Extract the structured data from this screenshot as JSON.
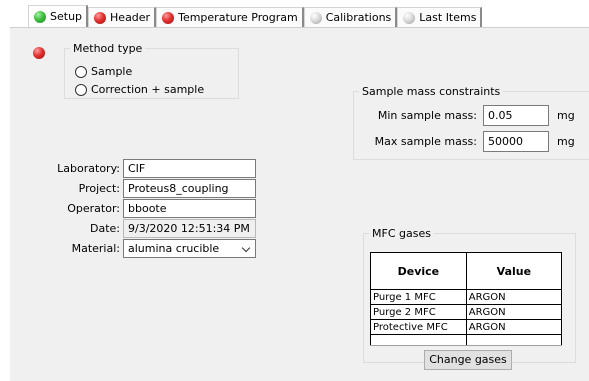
{
  "tabs": [
    {
      "label": "Setup",
      "status": "green",
      "active": true
    },
    {
      "label": "Header",
      "status": "red",
      "active": false
    },
    {
      "label": "Temperature Program",
      "status": "red",
      "active": false
    },
    {
      "label": "Calibrations",
      "status": "gray",
      "active": false
    },
    {
      "label": "Last Items",
      "status": "gray",
      "active": false
    }
  ],
  "status_colors": {
    "green": "#3fbf3f",
    "red": "#e23030",
    "gray": "#c8c8c8"
  },
  "method_type": {
    "legend": "Method type",
    "options": [
      {
        "label": "Sample",
        "checked": false
      },
      {
        "label": "Correction + sample",
        "checked": false
      }
    ]
  },
  "mass_constraints": {
    "legend": "Sample mass constraints",
    "min_label": "Min sample mass:",
    "min_value": "0.05",
    "max_label": "Max sample mass:",
    "max_value": "50000",
    "unit": "mg"
  },
  "info": {
    "laboratory_label": "Laboratory:",
    "laboratory_value": "CIF",
    "project_label": "Project:",
    "project_value": "Proteus8_coupling",
    "operator_label": "Operator:",
    "operator_value": "bboote",
    "date_label": "Date:",
    "date_value": "9/3/2020 12:51:34 PM",
    "material_label": "Material:",
    "material_value": "alumina crucible"
  },
  "mfc": {
    "legend": "MFC gases",
    "columns": [
      "Device",
      "Value"
    ],
    "rows": [
      {
        "device": "Purge 1 MFC",
        "value": "ARGON"
      },
      {
        "device": "Purge 2 MFC",
        "value": "ARGON"
      },
      {
        "device": "Protective MFC",
        "value": "ARGON"
      }
    ],
    "change_button": "Change gases"
  }
}
